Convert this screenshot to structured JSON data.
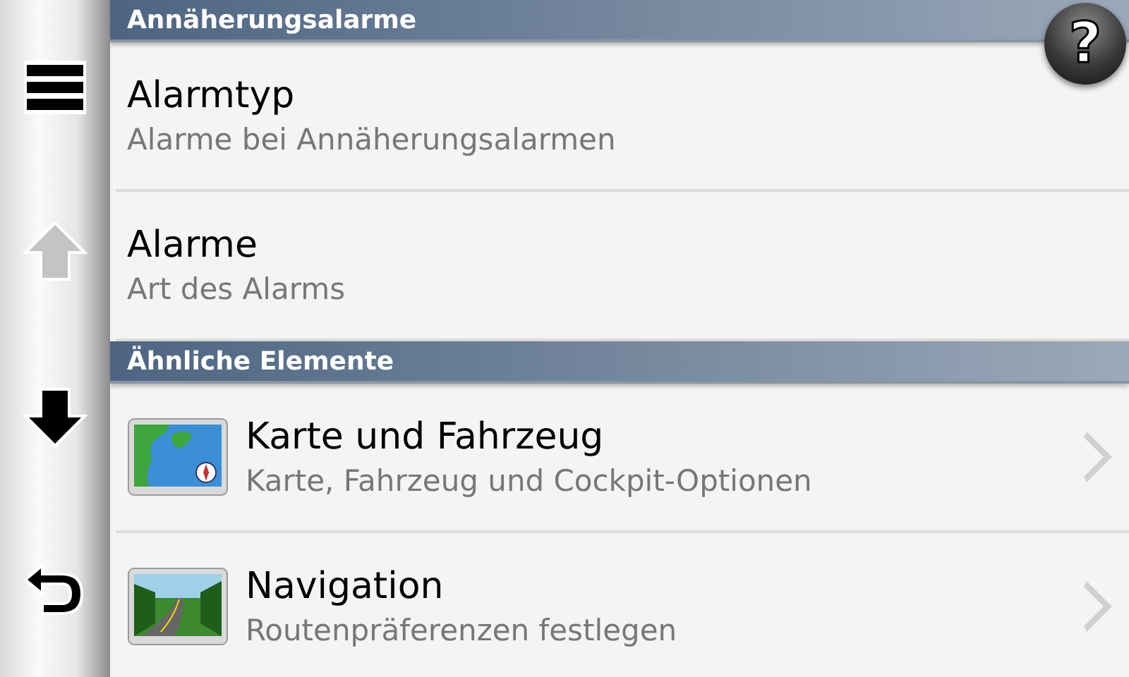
{
  "sidebar": {
    "buttons": [
      {
        "kind": "menu",
        "disabled": false
      },
      {
        "kind": "up",
        "disabled": true
      },
      {
        "kind": "down",
        "disabled": false
      },
      {
        "kind": "back",
        "disabled": false
      }
    ]
  },
  "help_button": {
    "label": "?"
  },
  "sections": [
    {
      "title": "Annäherungsalarme",
      "items": [
        {
          "title": "Alarmtyp",
          "subtitle": "Alarme bei Annäherungsalarmen",
          "kind": "plain",
          "chevron": false
        },
        {
          "title": "Alarme",
          "subtitle": "Art des Alarms",
          "kind": "plain",
          "chevron": false
        }
      ]
    },
    {
      "title": "Ähnliche Elemente",
      "items": [
        {
          "title": "Karte und Fahrzeug",
          "subtitle": "Karte, Fahrzeug und Cockpit-Optionen",
          "kind": "map",
          "chevron": true
        },
        {
          "title": "Navigation",
          "subtitle": "Routenpräferenzen festlegen",
          "kind": "road",
          "chevron": true
        }
      ]
    }
  ]
}
